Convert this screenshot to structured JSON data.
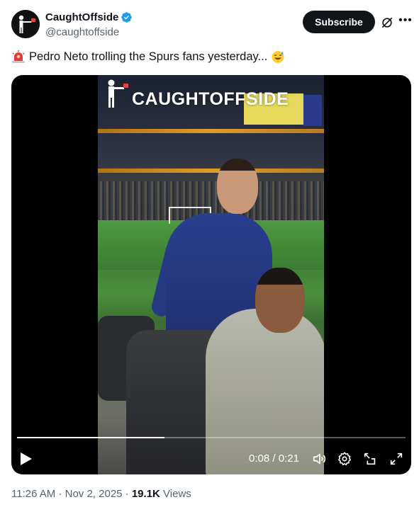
{
  "account": {
    "display_name": "CaughtOffside",
    "handle": "@caughtoffside",
    "verified": true,
    "avatar_icon": "referee-flag-avatar-icon"
  },
  "actions": {
    "subscribe_label": "Subscribe",
    "grok_icon": "grok-icon",
    "more_icon": "more-options-icon"
  },
  "tweet": {
    "leading_emoji": "siren-emoji",
    "text": "Pedro Neto trolling the Spurs fans yesterday...",
    "trailing_emoji": "sweat-smile-emoji"
  },
  "video": {
    "watermark": "CAUGHTOFFSIDE",
    "current_time": "0:08",
    "duration": "0:21",
    "time_separator": " / ",
    "progress_fraction": 0.38,
    "controls": [
      "play-icon",
      "volume-icon",
      "settings-icon",
      "picture-in-picture-icon",
      "fullscreen-icon"
    ]
  },
  "meta": {
    "time": "11:26 AM",
    "date": "Nov 2, 2025",
    "views_count": "19.1K",
    "views_label": "Views"
  },
  "colors": {
    "text_primary": "#0f1419",
    "text_secondary": "#536471",
    "verified_blue": "#1d9bf0",
    "subscribe_bg": "#0f1419"
  }
}
